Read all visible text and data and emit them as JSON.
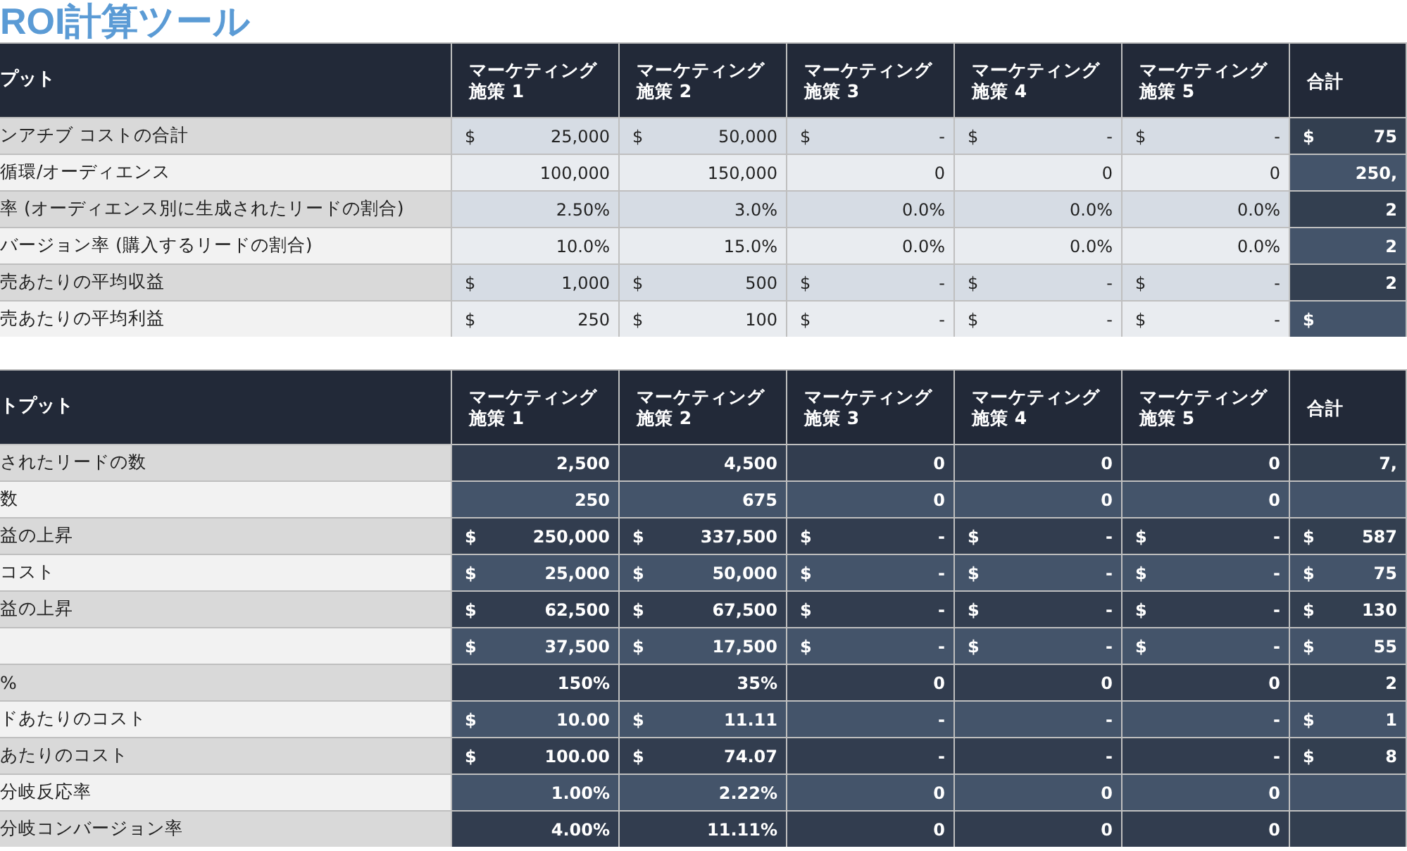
{
  "title": "ROI計算ツール",
  "tables": [
    {
      "kind": "input",
      "heading": "プット",
      "columns": [
        "マーケティング施策 1",
        "マーケティング施策 2",
        "マーケティング施策 3",
        "マーケティング施策 4",
        "マーケティング施策 5",
        "合計"
      ],
      "rows": [
        {
          "label": "ンアチブ コストの合計",
          "cells": [
            {
              "symbol": "$",
              "value": "25,000"
            },
            {
              "symbol": "$",
              "value": "50,000"
            },
            {
              "symbol": "$",
              "value": "-"
            },
            {
              "symbol": "$",
              "value": "-"
            },
            {
              "symbol": "$",
              "value": "-"
            },
            {
              "symbol": "$",
              "value": "75"
            }
          ]
        },
        {
          "label": "循環/オーディエンス",
          "cells": [
            {
              "value": "100,000"
            },
            {
              "value": "150,000"
            },
            {
              "value": "0"
            },
            {
              "value": "0"
            },
            {
              "value": "0"
            },
            {
              "value": "250,"
            }
          ]
        },
        {
          "label": "率 (オーディエンス別に生成されたリードの割合)",
          "cells": [
            {
              "value": "2.50%"
            },
            {
              "value": "3.0%"
            },
            {
              "value": "0.0%"
            },
            {
              "value": "0.0%"
            },
            {
              "value": "0.0%"
            },
            {
              "value": "2"
            }
          ]
        },
        {
          "label": "バージョン率 (購入するリードの割合)",
          "cells": [
            {
              "value": "10.0%"
            },
            {
              "value": "15.0%"
            },
            {
              "value": "0.0%"
            },
            {
              "value": "0.0%"
            },
            {
              "value": "0.0%"
            },
            {
              "value": "2"
            }
          ]
        },
        {
          "label": "売あたりの平均収益",
          "cells": [
            {
              "symbol": "$",
              "value": "1,000"
            },
            {
              "symbol": "$",
              "value": "500"
            },
            {
              "symbol": "$",
              "value": "-"
            },
            {
              "symbol": "$",
              "value": "-"
            },
            {
              "symbol": "$",
              "value": "-"
            },
            {
              "value": "2"
            }
          ]
        },
        {
          "label": "売あたりの平均利益",
          "cells": [
            {
              "symbol": "$",
              "value": "250"
            },
            {
              "symbol": "$",
              "value": "100"
            },
            {
              "symbol": "$",
              "value": "-"
            },
            {
              "symbol": "$",
              "value": "-"
            },
            {
              "symbol": "$",
              "value": "-"
            },
            {
              "symbol": "$"
            }
          ]
        }
      ]
    },
    {
      "kind": "output",
      "heading": "トプット",
      "columns": [
        "マーケティング施策 1",
        "マーケティング施策 2",
        "マーケティング施策 3",
        "マーケティング施策 4",
        "マーケティング施策 5",
        "合計"
      ],
      "rows": [
        {
          "label": "されたリードの数",
          "cells": [
            {
              "value": "2,500"
            },
            {
              "value": "4,500"
            },
            {
              "value": "0"
            },
            {
              "value": "0"
            },
            {
              "value": "0"
            },
            {
              "value": "7,"
            }
          ]
        },
        {
          "label": "数",
          "cells": [
            {
              "value": "250"
            },
            {
              "value": "675"
            },
            {
              "value": "0"
            },
            {
              "value": "0"
            },
            {
              "value": "0"
            },
            {}
          ]
        },
        {
          "label": "益の上昇",
          "cells": [
            {
              "symbol": "$",
              "value": "250,000"
            },
            {
              "symbol": "$",
              "value": "337,500"
            },
            {
              "symbol": "$",
              "value": "-"
            },
            {
              "symbol": "$",
              "value": "-"
            },
            {
              "symbol": "$",
              "value": "-"
            },
            {
              "symbol": "$",
              "value": "587"
            }
          ]
        },
        {
          "label": "コスト",
          "cells": [
            {
              "symbol": "$",
              "value": "25,000"
            },
            {
              "symbol": "$",
              "value": "50,000"
            },
            {
              "symbol": "$",
              "value": "-"
            },
            {
              "symbol": "$",
              "value": "-"
            },
            {
              "symbol": "$",
              "value": "-"
            },
            {
              "symbol": "$",
              "value": "75"
            }
          ]
        },
        {
          "label": "益の上昇",
          "cells": [
            {
              "symbol": "$",
              "value": "62,500"
            },
            {
              "symbol": "$",
              "value": "67,500"
            },
            {
              "symbol": "$",
              "value": "-"
            },
            {
              "symbol": "$",
              "value": "-"
            },
            {
              "symbol": "$",
              "value": "-"
            },
            {
              "symbol": "$",
              "value": "130"
            }
          ]
        },
        {
          "cells": [
            {
              "symbol": "$",
              "value": "37,500"
            },
            {
              "symbol": "$",
              "value": "17,500"
            },
            {
              "symbol": "$",
              "value": "-"
            },
            {
              "symbol": "$",
              "value": "-"
            },
            {
              "symbol": "$",
              "value": "-"
            },
            {
              "symbol": "$",
              "value": "55"
            }
          ]
        },
        {
          "label": "%",
          "cells": [
            {
              "value": "150%"
            },
            {
              "value": "35%"
            },
            {
              "value": "0"
            },
            {
              "value": "0"
            },
            {
              "value": "0"
            },
            {
              "value": "2"
            }
          ]
        },
        {
          "label": "ドあたりのコスト",
          "cells": [
            {
              "symbol": "$",
              "value": "10.00"
            },
            {
              "symbol": "$",
              "value": "11.11"
            },
            {
              "value": "-"
            },
            {
              "value": "-"
            },
            {
              "value": "-"
            },
            {
              "symbol": "$",
              "value": "1"
            }
          ]
        },
        {
          "label": "あたりのコスト",
          "cells": [
            {
              "symbol": "$",
              "value": "100.00"
            },
            {
              "symbol": "$",
              "value": "74.07"
            },
            {
              "value": "-"
            },
            {
              "value": "-"
            },
            {
              "value": "-"
            },
            {
              "symbol": "$",
              "value": "8"
            }
          ]
        },
        {
          "label": "分岐反応率",
          "cells": [
            {
              "value": "1.00%"
            },
            {
              "value": "2.22%"
            },
            {
              "value": "0"
            },
            {
              "value": "0"
            },
            {
              "value": "0"
            },
            {}
          ]
        },
        {
          "label": "分岐コンバージョン率",
          "cells": [
            {
              "value": "4.00%"
            },
            {
              "value": "11.11%"
            },
            {
              "value": "0"
            },
            {
              "value": "0"
            },
            {
              "value": "0"
            },
            {}
          ]
        }
      ]
    }
  ]
}
